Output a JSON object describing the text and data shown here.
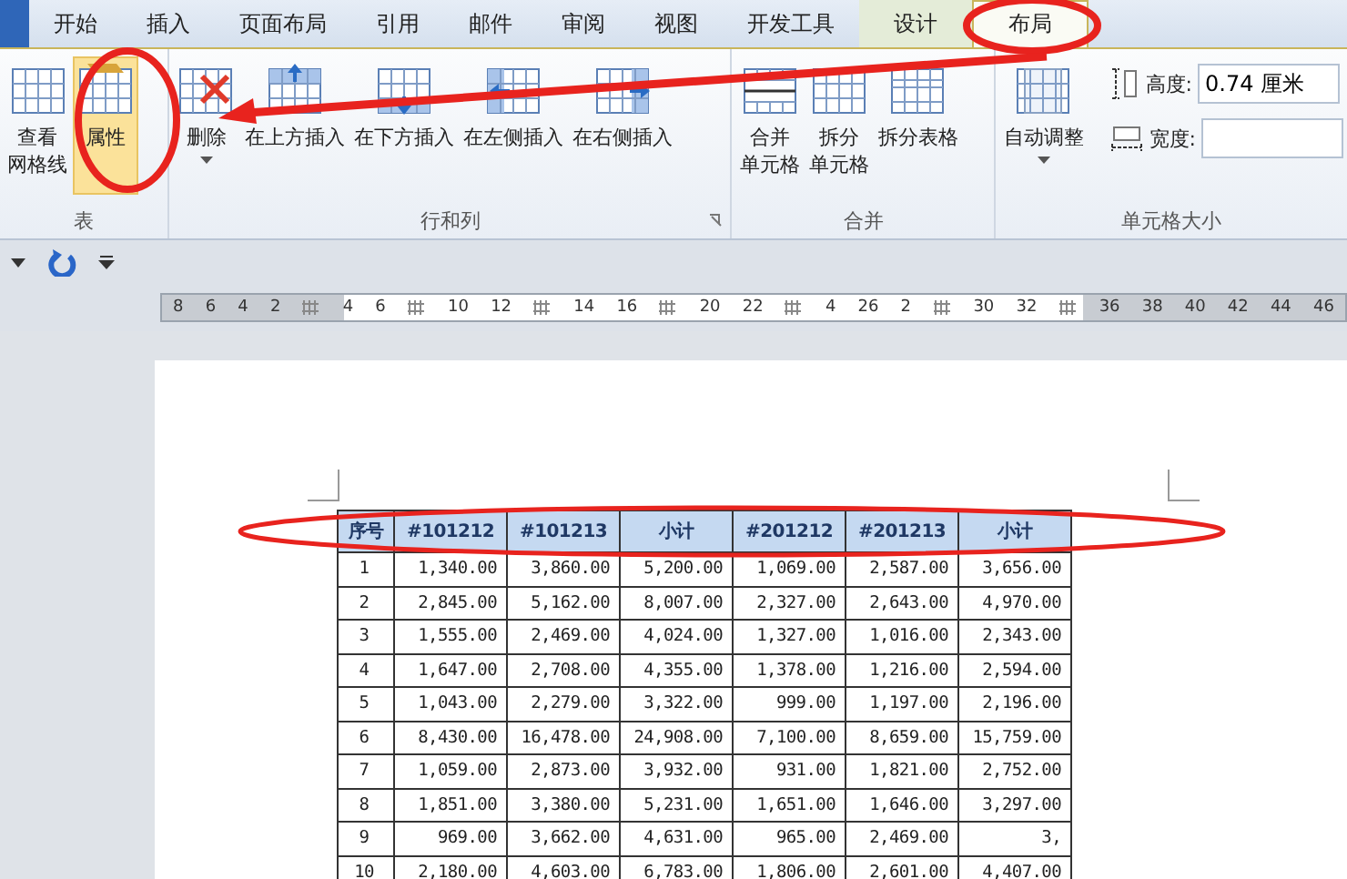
{
  "tabs": [
    {
      "label": "开始",
      "selected": false,
      "contextual": false
    },
    {
      "label": "插入",
      "selected": false,
      "contextual": false
    },
    {
      "label": "页面布局",
      "selected": false,
      "contextual": false
    },
    {
      "label": "引用",
      "selected": false,
      "contextual": false
    },
    {
      "label": "邮件",
      "selected": false,
      "contextual": false
    },
    {
      "label": "审阅",
      "selected": false,
      "contextual": false
    },
    {
      "label": "视图",
      "selected": false,
      "contextual": false
    },
    {
      "label": "开发工具",
      "selected": false,
      "contextual": false
    },
    {
      "label": "设计",
      "selected": false,
      "contextual": true
    },
    {
      "label": "布局",
      "selected": true,
      "contextual": true
    }
  ],
  "ribbon": {
    "groups": [
      {
        "label": "表",
        "items": [
          {
            "kind": "gridlines",
            "lines": [
              "查看",
              "网格线"
            ]
          },
          {
            "kind": "properties",
            "label": "属性",
            "highlighted": true
          }
        ]
      },
      {
        "label": "行和列",
        "launcher": true,
        "items": [
          {
            "kind": "delete",
            "label": "删除",
            "dropdown": true
          },
          {
            "kind": "insert-above",
            "label": "在上方插入"
          },
          {
            "kind": "insert-below",
            "label": "在下方插入"
          },
          {
            "kind": "insert-left",
            "label": "在左侧插入"
          },
          {
            "kind": "insert-right",
            "label": "在右侧插入"
          }
        ]
      },
      {
        "label": "合并",
        "items": [
          {
            "kind": "merge",
            "lines": [
              "合并",
              "单元格"
            ]
          },
          {
            "kind": "split-cells",
            "lines": [
              "拆分",
              "单元格"
            ]
          },
          {
            "kind": "split-table",
            "label": "拆分表格"
          }
        ]
      },
      {
        "label": "单元格大小",
        "items": [
          {
            "kind": "autofit",
            "label": "自动调整",
            "dropdown": true
          }
        ],
        "fields": [
          {
            "kind": "height",
            "label": "高度:",
            "value": "0.74 厘米"
          },
          {
            "kind": "width",
            "label": "宽度:"
          }
        ]
      }
    ]
  },
  "ruler": [
    {
      "kind": "num",
      "label": "8"
    },
    {
      "kind": "num",
      "label": "6"
    },
    {
      "kind": "num",
      "label": "4"
    },
    {
      "kind": "num",
      "label": "2"
    },
    {
      "kind": "col"
    },
    {
      "kind": "num",
      "label": "4"
    },
    {
      "kind": "num",
      "label": "6"
    },
    {
      "kind": "col"
    },
    {
      "kind": "num",
      "label": "10"
    },
    {
      "kind": "num",
      "label": "12"
    },
    {
      "kind": "col"
    },
    {
      "kind": "num",
      "label": "14"
    },
    {
      "kind": "num",
      "label": "16"
    },
    {
      "kind": "col"
    },
    {
      "kind": "num",
      "label": "20"
    },
    {
      "kind": "num",
      "label": "22"
    },
    {
      "kind": "col"
    },
    {
      "kind": "num",
      "label": "4"
    },
    {
      "kind": "num",
      "label": "26"
    },
    {
      "kind": "num",
      "label": "2"
    },
    {
      "kind": "col"
    },
    {
      "kind": "num",
      "label": "30"
    },
    {
      "kind": "num",
      "label": "32"
    },
    {
      "kind": "col"
    },
    {
      "kind": "num",
      "label": "36"
    },
    {
      "kind": "num",
      "label": "38"
    },
    {
      "kind": "num",
      "label": "40"
    },
    {
      "kind": "num",
      "label": "42"
    },
    {
      "kind": "num",
      "label": "44"
    },
    {
      "kind": "num",
      "label": "46"
    }
  ],
  "table": {
    "columns": [
      "序号",
      "#101212",
      "#101213",
      "小计",
      "#201212",
      "#201213",
      "小计"
    ],
    "rows": [
      [
        "1",
        "1,340.00",
        "3,860.00",
        "5,200.00",
        "1,069.00",
        "2,587.00",
        "3,656.00"
      ],
      [
        "2",
        "2,845.00",
        "5,162.00",
        "8,007.00",
        "2,327.00",
        "2,643.00",
        "4,970.00"
      ],
      [
        "3",
        "1,555.00",
        "2,469.00",
        "4,024.00",
        "1,327.00",
        "1,016.00",
        "2,343.00"
      ],
      [
        "4",
        "1,647.00",
        "2,708.00",
        "4,355.00",
        "1,378.00",
        "1,216.00",
        "2,594.00"
      ],
      [
        "5",
        "1,043.00",
        "2,279.00",
        "3,322.00",
        "999.00",
        "1,197.00",
        "2,196.00"
      ],
      [
        "6",
        "8,430.00",
        "16,478.00",
        "24,908.00",
        "7,100.00",
        "8,659.00",
        "15,759.00"
      ],
      [
        "7",
        "1,059.00",
        "2,873.00",
        "3,932.00",
        "931.00",
        "1,821.00",
        "2,752.00"
      ],
      [
        "8",
        "1,851.00",
        "3,380.00",
        "5,231.00",
        "1,651.00",
        "1,646.00",
        "3,297.00"
      ],
      [
        "9",
        "969.00",
        "3,662.00",
        "4,631.00",
        "965.00",
        "2,469.00",
        "3,"
      ],
      [
        "10",
        "2,180.00",
        "4,603.00",
        "6,783.00",
        "1,806.00",
        "2,601.00",
        "4,407.00"
      ]
    ]
  }
}
